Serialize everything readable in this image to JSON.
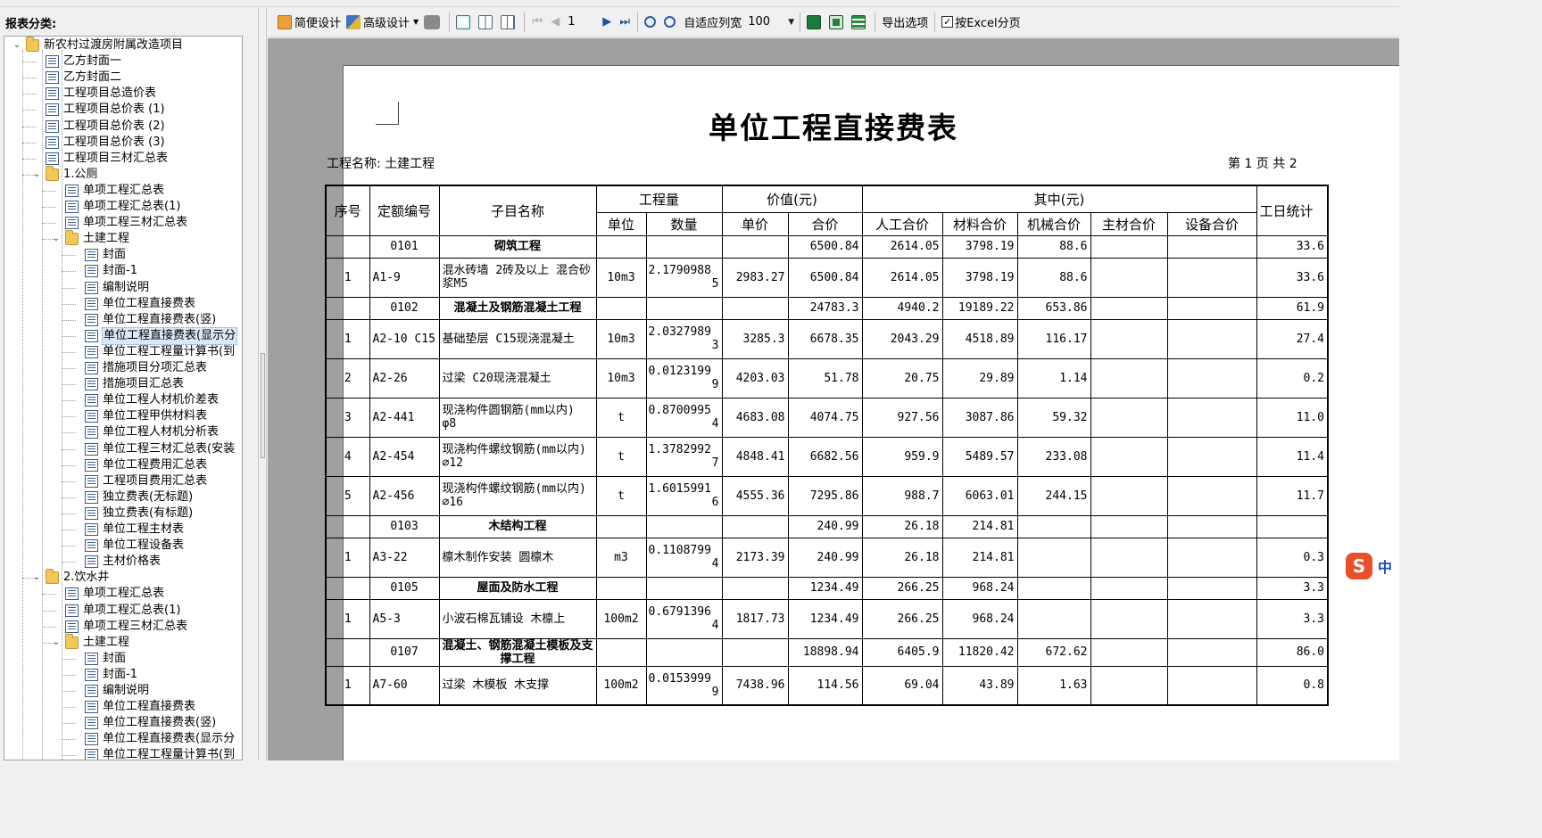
{
  "left_panel": {
    "header": "报表分类:"
  },
  "tree": {
    "nodes": [
      {
        "label": "新农村过渡房附属改造项目",
        "type": "folder",
        "level": 0,
        "expanded": true
      },
      {
        "label": "乙方封面一",
        "type": "doc",
        "level": 1
      },
      {
        "label": "乙方封面二",
        "type": "doc",
        "level": 1
      },
      {
        "label": "工程项目总造价表",
        "type": "doc",
        "level": 1
      },
      {
        "label": "工程项目总价表 (1)",
        "type": "doc",
        "level": 1
      },
      {
        "label": "工程项目总价表 (2)",
        "type": "doc",
        "level": 1
      },
      {
        "label": "工程项目总价表 (3)",
        "type": "doc",
        "level": 1
      },
      {
        "label": "工程项目三材汇总表",
        "type": "doc",
        "level": 1
      },
      {
        "label": "1.公厕",
        "type": "folder",
        "level": 1,
        "expanded": true
      },
      {
        "label": "单项工程汇总表",
        "type": "doc",
        "level": 2
      },
      {
        "label": "单项工程汇总表(1)",
        "type": "doc",
        "level": 2
      },
      {
        "label": "单项工程三材汇总表",
        "type": "doc",
        "level": 2
      },
      {
        "label": "土建工程",
        "type": "folder",
        "level": 2,
        "expanded": true
      },
      {
        "label": "封面",
        "type": "doc",
        "level": 3
      },
      {
        "label": "封面-1",
        "type": "doc",
        "level": 3
      },
      {
        "label": "编制说明",
        "type": "doc",
        "level": 3
      },
      {
        "label": "单位工程直接费表",
        "type": "doc",
        "level": 3
      },
      {
        "label": "单位工程直接费表(竖)",
        "type": "doc",
        "level": 3
      },
      {
        "label": "单位工程直接费表(显示分",
        "type": "doc",
        "level": 3,
        "selected": true
      },
      {
        "label": "单位工程工程量计算书(到",
        "type": "doc",
        "level": 3
      },
      {
        "label": "措施项目分项汇总表",
        "type": "doc",
        "level": 3
      },
      {
        "label": "措施项目汇总表",
        "type": "doc",
        "level": 3
      },
      {
        "label": "单位工程人材机价差表",
        "type": "doc",
        "level": 3
      },
      {
        "label": "单位工程甲供材料表",
        "type": "doc",
        "level": 3
      },
      {
        "label": "单位工程人材机分析表",
        "type": "doc",
        "level": 3
      },
      {
        "label": "单位工程三材汇总表(安装",
        "type": "doc",
        "level": 3
      },
      {
        "label": "单位工程费用汇总表",
        "type": "doc",
        "level": 3
      },
      {
        "label": "工程项目费用汇总表",
        "type": "doc",
        "level": 3
      },
      {
        "label": "独立费表(无标题)",
        "type": "doc",
        "level": 3
      },
      {
        "label": "独立费表(有标题)",
        "type": "doc",
        "level": 3
      },
      {
        "label": "单位工程主材表",
        "type": "doc",
        "level": 3
      },
      {
        "label": "单位工程设备表",
        "type": "doc",
        "level": 3
      },
      {
        "label": "主材价格表",
        "type": "doc",
        "level": 3
      },
      {
        "label": "2.饮水井",
        "type": "folder",
        "level": 1,
        "expanded": true
      },
      {
        "label": "单项工程汇总表",
        "type": "doc",
        "level": 2
      },
      {
        "label": "单项工程汇总表(1)",
        "type": "doc",
        "level": 2
      },
      {
        "label": "单项工程三材汇总表",
        "type": "doc",
        "level": 2
      },
      {
        "label": "土建工程",
        "type": "folder",
        "level": 2,
        "expanded": true
      },
      {
        "label": "封面",
        "type": "doc",
        "level": 3
      },
      {
        "label": "封面-1",
        "type": "doc",
        "level": 3
      },
      {
        "label": "编制说明",
        "type": "doc",
        "level": 3
      },
      {
        "label": "单位工程直接费表",
        "type": "doc",
        "level": 3
      },
      {
        "label": "单位工程直接费表(竖)",
        "type": "doc",
        "level": 3
      },
      {
        "label": "单位工程直接费表(显示分",
        "type": "doc",
        "level": 3
      },
      {
        "label": "单位工程工程量计算书(到",
        "type": "doc",
        "level": 3
      }
    ]
  },
  "toolbar": {
    "simple_design": "简便设计",
    "advanced_design": "高级设计",
    "page_number": "1",
    "fit_column_width": "自适应列宽",
    "zoom": "100",
    "export_options": "导出选项",
    "excel_paging": "按Excel分页",
    "excel_paging_checked": true
  },
  "report": {
    "title": "单位工程直接费表",
    "project_label": "工程名称: 土建工程",
    "page_label": "第 1 页  共 2",
    "headers": {
      "seq": "序号",
      "code": "定额编号",
      "name": "子目名称",
      "quantity_group": "工程量",
      "unit": "单位",
      "qty": "数量",
      "value_group": "价值(元)",
      "unit_price": "单价",
      "total_price": "合价",
      "breakdown_group": "其中(元)",
      "labor": "人工合价",
      "material": "材料合价",
      "machine": "机械合价",
      "main_material": "主材合价",
      "equipment": "设备合价",
      "workday": "工日统计"
    },
    "rows": [
      {
        "kind": "section",
        "seq": "",
        "code": "0101",
        "name": "砌筑工程",
        "unit": "",
        "qty1": "",
        "qty2": "",
        "price": "",
        "total": "6500.84",
        "labor": "2614.05",
        "material": "3798.19",
        "machine": "88.6",
        "main": "",
        "equip": "",
        "workday": "33.6"
      },
      {
        "kind": "item",
        "seq": "1",
        "code": "A1-9",
        "name": "混水砖墙 2砖及以上 混合砂浆M5",
        "unit": "10m3",
        "qty1": "2.1790988",
        "qty2": "5",
        "price": "2983.27",
        "total": "6500.84",
        "labor": "2614.05",
        "material": "3798.19",
        "machine": "88.6",
        "main": "",
        "equip": "",
        "workday": "33.6"
      },
      {
        "kind": "section",
        "seq": "",
        "code": "0102",
        "name": "混凝土及钢筋混凝土工程",
        "unit": "",
        "qty1": "",
        "qty2": "",
        "price": "",
        "total": "24783.3",
        "labor": "4940.2",
        "material": "19189.22",
        "machine": "653.86",
        "main": "",
        "equip": "",
        "workday": "61.9"
      },
      {
        "kind": "item",
        "seq": "1",
        "code": "A2-10 C15",
        "name": "基础垫层 C15现浇混凝土",
        "unit": "10m3",
        "qty1": "2.0327989",
        "qty2": "3",
        "price": "3285.3",
        "total": "6678.35",
        "labor": "2043.29",
        "material": "4518.89",
        "machine": "116.17",
        "main": "",
        "equip": "",
        "workday": "27.4"
      },
      {
        "kind": "item",
        "seq": "2",
        "code": "A2-26",
        "name": "过梁 C20现浇混凝土",
        "unit": "10m3",
        "qty1": "0.0123199",
        "qty2": "9",
        "price": "4203.03",
        "total": "51.78",
        "labor": "20.75",
        "material": "29.89",
        "machine": "1.14",
        "main": "",
        "equip": "",
        "workday": "0.2"
      },
      {
        "kind": "item",
        "seq": "3",
        "code": "A2-441",
        "name": "现浇构件圆钢筋(mm以内) φ8",
        "unit": "t",
        "qty1": "0.8700995",
        "qty2": "4",
        "price": "4683.08",
        "total": "4074.75",
        "labor": "927.56",
        "material": "3087.86",
        "machine": "59.32",
        "main": "",
        "equip": "",
        "workday": "11.0"
      },
      {
        "kind": "item",
        "seq": "4",
        "code": "A2-454",
        "name": "现浇构件螺纹钢筋(mm以内) ⌀12",
        "unit": "t",
        "qty1": "1.3782992",
        "qty2": "7",
        "price": "4848.41",
        "total": "6682.56",
        "labor": "959.9",
        "material": "5489.57",
        "machine": "233.08",
        "main": "",
        "equip": "",
        "workday": "11.4"
      },
      {
        "kind": "item",
        "seq": "5",
        "code": "A2-456",
        "name": "现浇构件螺纹钢筋(mm以内) ⌀16",
        "unit": "t",
        "qty1": "1.6015991",
        "qty2": "6",
        "price": "4555.36",
        "total": "7295.86",
        "labor": "988.7",
        "material": "6063.01",
        "machine": "244.15",
        "main": "",
        "equip": "",
        "workday": "11.7"
      },
      {
        "kind": "section",
        "seq": "",
        "code": "0103",
        "name": "木结构工程",
        "unit": "",
        "qty1": "",
        "qty2": "",
        "price": "",
        "total": "240.99",
        "labor": "26.18",
        "material": "214.81",
        "machine": "",
        "main": "",
        "equip": "",
        "workday": ""
      },
      {
        "kind": "item",
        "seq": "1",
        "code": "A3-22",
        "name": "檩木制作安装 圆檩木",
        "unit": "m3",
        "qty1": "0.1108799",
        "qty2": "4",
        "price": "2173.39",
        "total": "240.99",
        "labor": "26.18",
        "material": "214.81",
        "machine": "",
        "main": "",
        "equip": "",
        "workday": "0.3"
      },
      {
        "kind": "section",
        "seq": "",
        "code": "0105",
        "name": "屋面及防水工程",
        "unit": "",
        "qty1": "",
        "qty2": "",
        "price": "",
        "total": "1234.49",
        "labor": "266.25",
        "material": "968.24",
        "machine": "",
        "main": "",
        "equip": "",
        "workday": "3.3"
      },
      {
        "kind": "item",
        "seq": "1",
        "code": "A5-3",
        "name": "小波石棉瓦铺设 木檩上",
        "unit": "100m2",
        "qty1": "0.6791396",
        "qty2": "4",
        "price": "1817.73",
        "total": "1234.49",
        "labor": "266.25",
        "material": "968.24",
        "machine": "",
        "main": "",
        "equip": "",
        "workday": "3.3"
      },
      {
        "kind": "section",
        "seq": "",
        "code": "0107",
        "name": "混凝土、钢筋混凝土模板及支撑工程",
        "unit": "",
        "qty1": "",
        "qty2": "",
        "price": "",
        "total": "18898.94",
        "labor": "6405.9",
        "material": "11820.42",
        "machine": "672.62",
        "main": "",
        "equip": "",
        "workday": "86.0"
      },
      {
        "kind": "item",
        "seq": "1",
        "code": "A7-60",
        "name": "过梁 木模板 木支撑",
        "unit": "100m2",
        "qty1": "0.0153999",
        "qty2": "9",
        "price": "7438.96",
        "total": "114.56",
        "labor": "69.04",
        "material": "43.89",
        "machine": "1.63",
        "main": "",
        "equip": "",
        "workday": "0.8"
      }
    ]
  },
  "ime": {
    "logo": "S",
    "mode": "中"
  }
}
